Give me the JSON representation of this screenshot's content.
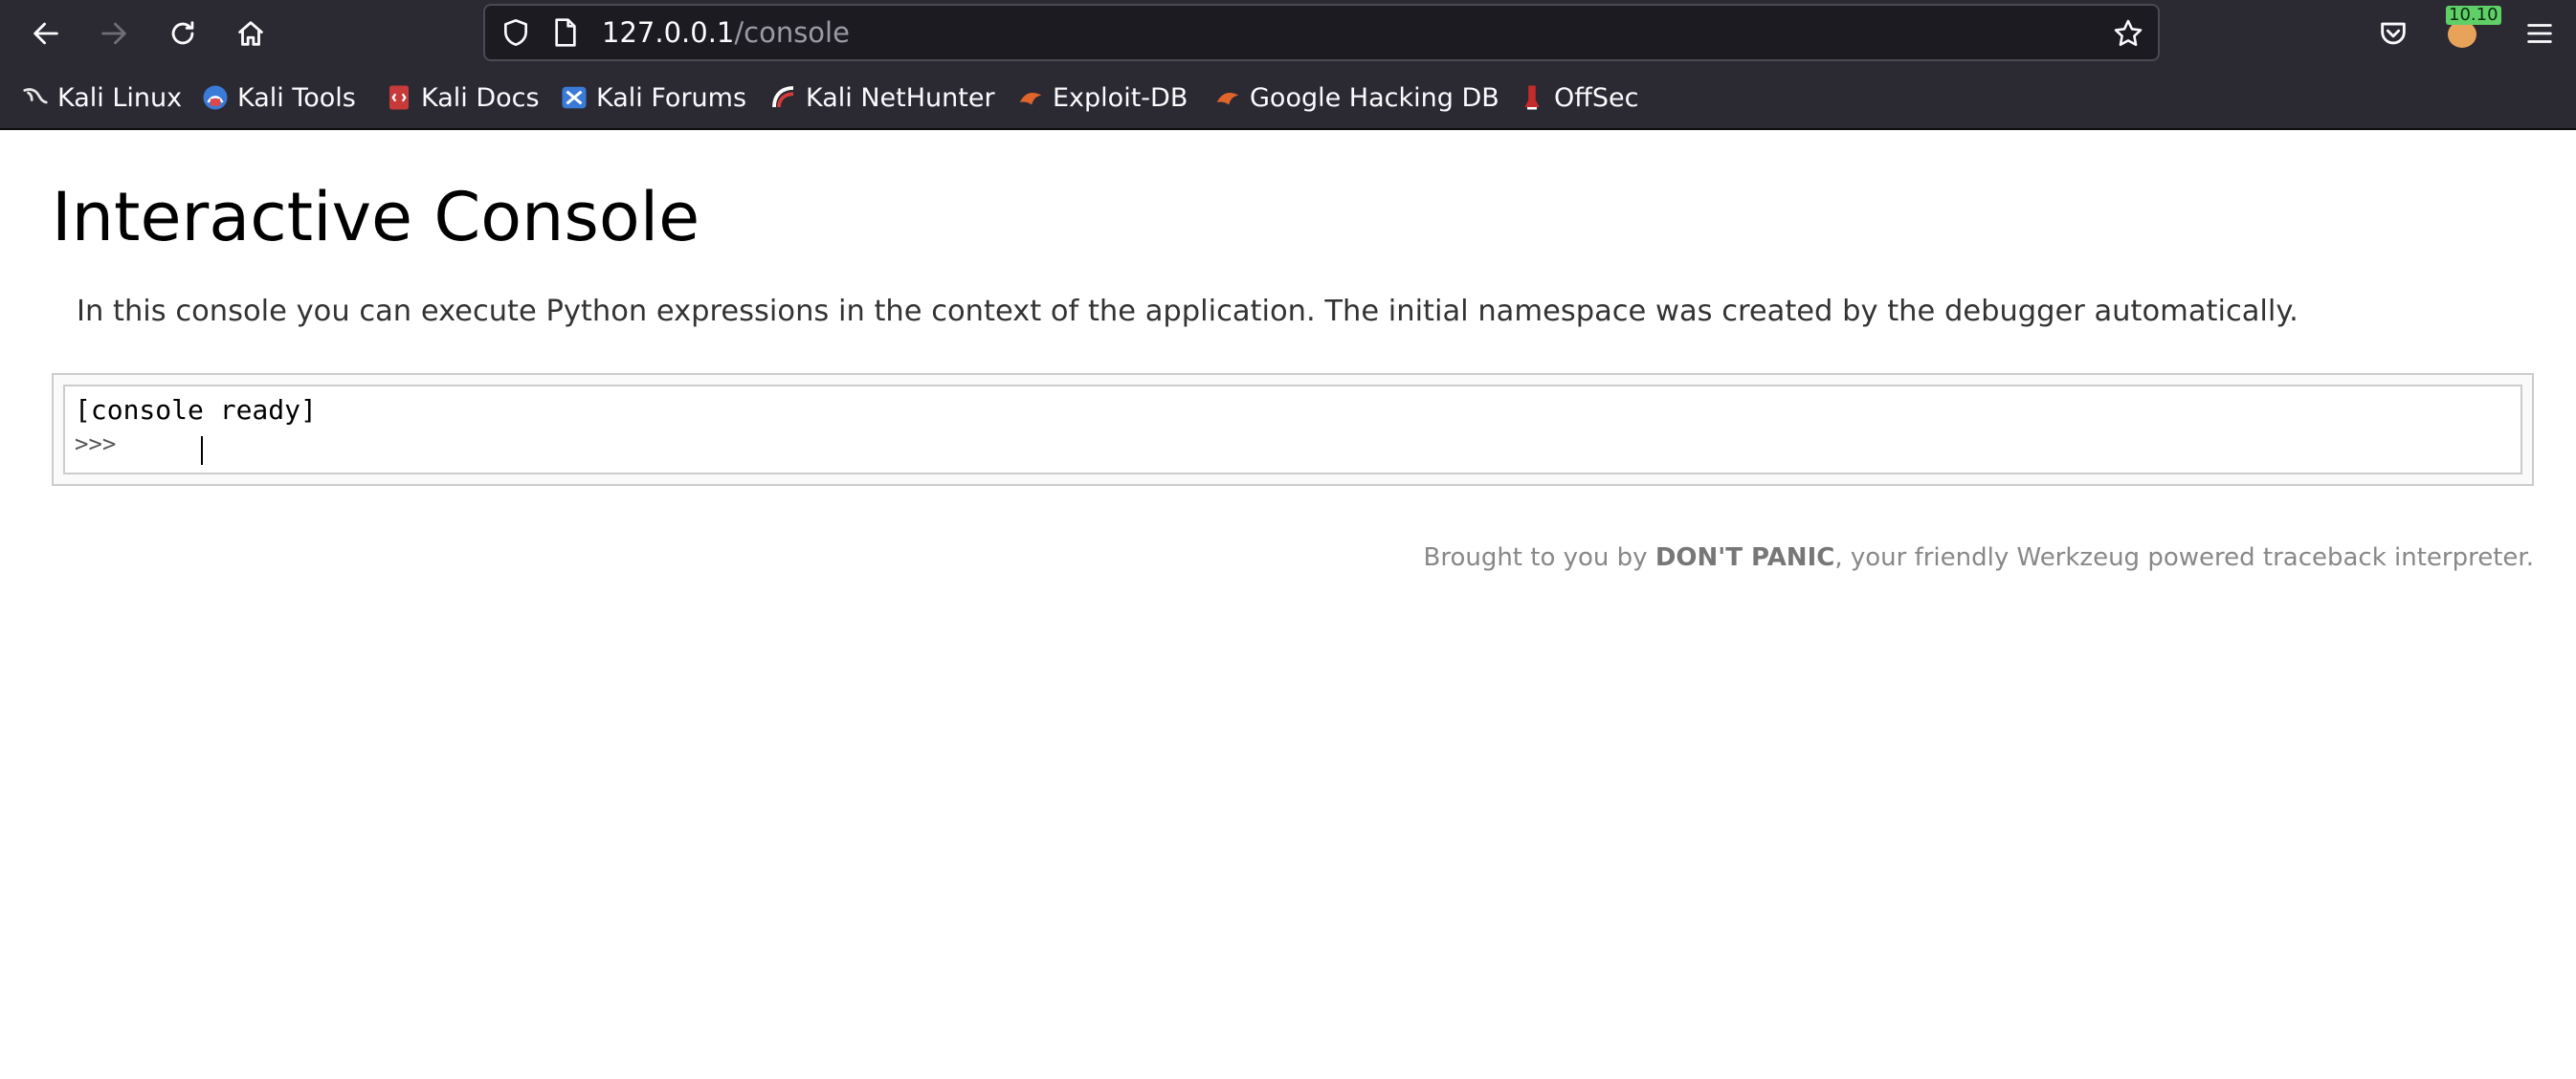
{
  "browser": {
    "url_host": "127.0.0.1",
    "url_path": "/console",
    "extension_badge": "10.10"
  },
  "bookmarks": [
    {
      "label": "Kali Linux",
      "icon": "kali-dragon-icon"
    },
    {
      "label": "Kali Tools",
      "icon": "kali-tools-icon"
    },
    {
      "label": "Kali Docs",
      "icon": "kali-docs-icon"
    },
    {
      "label": "Kali Forums",
      "icon": "kali-forums-icon"
    },
    {
      "label": "Kali NetHunter",
      "icon": "kali-nethunter-icon"
    },
    {
      "label": "Exploit-DB",
      "icon": "exploit-db-icon"
    },
    {
      "label": "Google Hacking DB",
      "icon": "google-hacking-db-icon"
    },
    {
      "label": "OffSec",
      "icon": "offsec-icon"
    }
  ],
  "page": {
    "title": "Interactive Console",
    "explanation": "In this console you can execute Python expressions in the context of the application. The initial namespace was created by the debugger automatically.",
    "console_ready": "[console ready]",
    "prompt": ">>>",
    "footer_prefix": "Brought to you by ",
    "footer_bold": "DON'T PANIC",
    "footer_suffix": ", your friendly Werkzeug powered traceback interpreter."
  },
  "colors": {
    "toolbar_bg": "#2b2a33",
    "urlbar_bg": "#1c1b22",
    "page_bg": "#ffffff"
  }
}
